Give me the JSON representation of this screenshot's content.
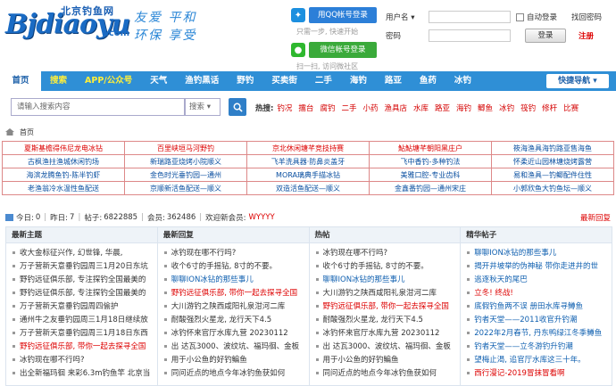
{
  "logo": {
    "cn": "北京钓鱼网",
    "en": "Bjdiaoyu",
    "com": ".com"
  },
  "slogan": {
    "line1": "友爱 平和",
    "line2": "环保 享受"
  },
  "social": {
    "qq_label": "用QQ帐号登录",
    "qq_hint": "只需一步, 快速开始",
    "wx_label": "微信帐号登录",
    "wx_hint": "扫一扫, 访问微社区"
  },
  "login": {
    "username_label": "用户名",
    "password_label": "密码",
    "auto_login": "自动登录",
    "forgot": "找回密码",
    "login_btn": "登录",
    "register": "注册"
  },
  "nav": {
    "items": [
      "首页",
      "搜索",
      "APP/公众号",
      "天气",
      "渔钓黑话",
      "野钓",
      "买卖街",
      "二手",
      "海钓",
      "路亚",
      "鱼药",
      "冰钓"
    ],
    "quick": "快捷导航 ▾"
  },
  "search": {
    "placeholder": "请输入搜索内容",
    "select": "搜索",
    "hot_label": "热搜:",
    "hot": [
      "钓况",
      "擂台",
      "腐钓",
      "二手",
      "小药",
      "渔具店",
      "水库",
      "路亚",
      "海钓",
      "鲫鱼",
      "冰钓",
      "筏钓",
      "修杆",
      "比赛"
    ]
  },
  "breadcrumb": "首页",
  "links": [
    [
      {
        "t": "夏斯基檐得伟尼龙电冰钻",
        "red": true
      },
      {
        "t": "百里峡垣马河野钓",
        "red": true
      },
      {
        "t": "京北休闲塘芊竞技持赛",
        "red": true
      },
      {
        "t": "鮎鮎塘芊朝阳黑庄户",
        "red": true
      },
      {
        "t": "筱海渔具海钓路亚售海鱼",
        "red": false
      }
    ],
    [
      {
        "t": "古枫渔拄渔城休闲钓场",
        "red": false
      },
      {
        "t": "新瑞路亚烧烤小院顺义",
        "red": false
      },
      {
        "t": "飞羊洗具器·防鼻炎盖牙",
        "red": false
      },
      {
        "t": "飞中香钓-多种钓法",
        "red": false
      },
      {
        "t": "怀柔近山园林塘烧烤露营",
        "red": false
      }
    ],
    [
      {
        "t": "海滨龙腾鱼钓-陈半钓虾",
        "red": false
      },
      {
        "t": "金色时光垂钓园—通州",
        "red": false
      },
      {
        "t": "MORA璃典手描冰钻",
        "red": false
      },
      {
        "t": "美雅口腔-专业齿科",
        "red": false
      },
      {
        "t": "易和渔具—钓鲫配件住性",
        "red": false
      }
    ],
    [
      {
        "t": "老渔翁冷水温性鱼配送",
        "red": false
      },
      {
        "t": "京顺新活鱼配送—顺义",
        "red": false
      },
      {
        "t": "双造活鱼配送—顺义",
        "red": false
      },
      {
        "t": "金鑫番钓园—通州宋庄",
        "red": false
      },
      {
        "t": "小郭欣鱼大钓鱼坛—顺义",
        "red": false
      }
    ]
  ],
  "stats": {
    "today_label": "今日:",
    "today": "0",
    "yesterday_label": "昨日:",
    "yesterday": "7",
    "posts_label": "帖子:",
    "posts": "6822885",
    "members_label": "会员:",
    "members": "362486",
    "welcome_label": "欢迎新会员:",
    "newest": "WYYYY",
    "latest_reply": "最新回复"
  },
  "columns": [
    {
      "title": "最新主题",
      "items": [
        {
          "t": "收大金标征兴作, 幻世锋, 华晨,",
          "c": ""
        },
        {
          "t": "万子营新天意垂钓园周三1月20日东坑",
          "c": ""
        },
        {
          "t": "野钓远征俱乐部, 专注探钓全国最美的",
          "c": ""
        },
        {
          "t": "野钓远征俱乐部, 专注探钓全国最美的",
          "c": ""
        },
        {
          "t": "万子营新天意垂钓园周四偷护",
          "c": ""
        },
        {
          "t": "通州牛之友垂钓园周三1月18日继续放",
          "c": ""
        },
        {
          "t": "万子营新天意垂钓园周三1月18日东西",
          "c": ""
        },
        {
          "t": "野钓远征俱乐部, 带你一起去探寻全国",
          "c": "red"
        },
        {
          "t": "冰钓现在哪不行吗?",
          "c": ""
        },
        {
          "t": "出全新福玛徊 来彩6.3m钓鱼竿 北京当",
          "c": ""
        }
      ]
    },
    {
      "title": "最新回复",
      "items": [
        {
          "t": "冰钓现在哪不行吗?",
          "c": ""
        },
        {
          "t": "收个6寸的手摇钻, 8寸的不要。",
          "c": ""
        },
        {
          "t": "聊聊ION冰钻的那些事儿",
          "c": "blue"
        },
        {
          "t": "野钓远征俱乐部, 带你一起去探寻全国",
          "c": "red"
        },
        {
          "t": "大川游钓之陕西咸阳礼泉泔河二库",
          "c": ""
        },
        {
          "t": "耐酸强烈火星龙, 龙行天下4.5",
          "c": ""
        },
        {
          "t": "冰钓怀来官厅水库九营 20230112",
          "c": ""
        },
        {
          "t": "出 达瓦3000、波纹坑、福玛徊、金板",
          "c": ""
        },
        {
          "t": "用于小公鱼的好钓鳊鱼",
          "c": ""
        },
        {
          "t": "同问近点的地点今年冰钓鱼获如何",
          "c": ""
        }
      ]
    },
    {
      "title": "热帖",
      "items": [
        {
          "t": "冰钓现在哪不行吗?",
          "c": ""
        },
        {
          "t": "收个6寸的手摇钻, 8寸的不要。",
          "c": ""
        },
        {
          "t": "聊聊ION冰钻的那些事儿",
          "c": "blue"
        },
        {
          "t": "大川游钓之陕西咸阳礼泉泔河二库",
          "c": ""
        },
        {
          "t": "野钓远征俱乐部, 带你一起去探寻全国",
          "c": "red"
        },
        {
          "t": "耐酸强烈火星龙, 龙行天下4.5",
          "c": ""
        },
        {
          "t": "冰钓怀来官厅水库九营 20230112",
          "c": ""
        },
        {
          "t": "出 达瓦3000、波纹坑、福玛徊、金板",
          "c": ""
        },
        {
          "t": "用于小公鱼的好钓鳊鱼",
          "c": ""
        },
        {
          "t": "同问近点的地点今年冰钓鱼获如何",
          "c": ""
        }
      ]
    },
    {
      "title": "精华帖子",
      "items": [
        {
          "t": "聊聊ION冰钻的那些事儿",
          "c": "blue"
        },
        {
          "t": "揭开井坡举的伪神秘 带你走进井的世",
          "c": "blue"
        },
        {
          "t": "逃逐秋天的尾巴",
          "c": "blue"
        },
        {
          "t": "立冬! 终战!",
          "c": "red"
        },
        {
          "t": "底假钓鱼两不误 册田水库寻鳟鱼",
          "c": "blue"
        },
        {
          "t": "钓者天堂——2011收官升钓潮",
          "c": "blue"
        },
        {
          "t": "2022年2月春节, 丹东鸭绿江冬季鳟鱼",
          "c": "blue"
        },
        {
          "t": "钓者天堂——立冬游钓升钓潮",
          "c": "blue"
        },
        {
          "t": "望梅止渴, 追官厅水库这三十年。",
          "c": "blue"
        },
        {
          "t": "西行漫记-2019冒抹冒看啊",
          "c": "red"
        }
      ]
    }
  ]
}
